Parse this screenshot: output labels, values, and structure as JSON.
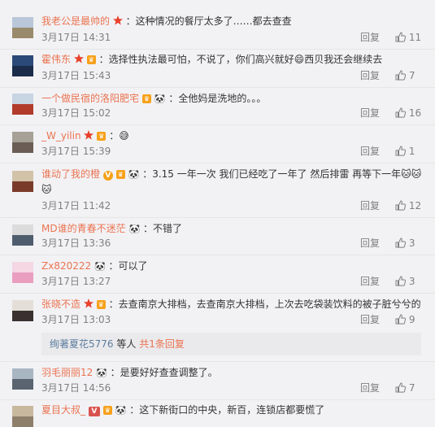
{
  "comments": [
    {
      "user": "我老公是最帅的",
      "text": "：这种情况的餐厅太多了……都去查查",
      "time": "3月17日 14:31",
      "reply": "回复",
      "likes": "11"
    },
    {
      "user": "霍伟东",
      "text": "：选择性执法最可怕，不说了，你们高兴就好",
      "text2": "西贝我还会继续去",
      "time": "3月17日 15:43",
      "reply": "回复",
      "likes": "7"
    },
    {
      "user": "一个做民宿的洛阳肥宅",
      "text": "：全他妈是洗地的。。。",
      "time": "3月17日 15:02",
      "reply": "回复",
      "likes": "16"
    },
    {
      "user": "_W_yilin",
      "text": "：",
      "time": "3月17日 15:39",
      "reply": "回复",
      "likes": "1"
    },
    {
      "user": "谁动了我的橙",
      "text": "：3.15 一年一次 我们已经吃了一年了 然后排雷 再等下一年",
      "time": "3月17日 11:42",
      "reply": "回复",
      "likes": "12"
    },
    {
      "user": "MD谁的青春不迷茫",
      "text": "：不错了",
      "time": "3月17日 13:36",
      "reply": "回复",
      "likes": "3"
    },
    {
      "user": "Zx820222",
      "text": "：可以了",
      "time": "3月17日 13:27",
      "reply": "回复",
      "likes": "3"
    },
    {
      "user": "张晓不造",
      "text": "：去查南京大排档，去查南京大排档，上次去吃袋装饮料的被子脏兮兮的",
      "time": "3月17日 13:03",
      "reply": "回复",
      "likes": "9"
    },
    {
      "user": "羽毛丽丽12",
      "text": "：是要好好查查调整了。",
      "time": "3月17日 14:56",
      "reply": "回复",
      "likes": "7"
    },
    {
      "user": "夏目大叔_",
      "text": "：这下新街口的中央，新百，连锁店都要慌了",
      "time": "",
      "reply": "",
      "likes": ""
    }
  ],
  "subreply": {
    "name": "绚著夏花5776",
    "mid": " 等人 ",
    "count": "共1条回复"
  },
  "icons": {
    "like": "thumbs-up-icon",
    "star": "star-badge-icon",
    "vip": "vip-badge-icon",
    "panda": "panda-emoji-icon"
  },
  "colors": {
    "username": "#eb7350",
    "meta": "#808080",
    "background": "#f2f2f5",
    "link": "#5d7d9f"
  }
}
